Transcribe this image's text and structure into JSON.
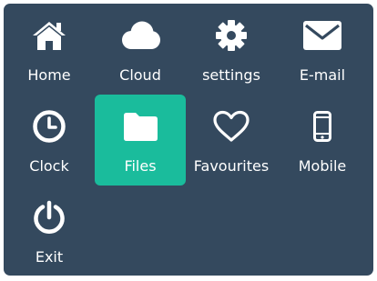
{
  "colors": {
    "panel_background": "#34495e",
    "active_tile_background": "#1abc9c",
    "icon_and_text": "#ffffff"
  },
  "menu": {
    "active_item": "Files",
    "items": [
      {
        "label": "Home",
        "icon": "home-icon"
      },
      {
        "label": "Cloud",
        "icon": "cloud-icon"
      },
      {
        "label": "settings",
        "icon": "gear-icon"
      },
      {
        "label": "E-mail",
        "icon": "envelope-icon"
      },
      {
        "label": "Clock",
        "icon": "clock-icon"
      },
      {
        "label": "Files",
        "icon": "folder-icon"
      },
      {
        "label": "Favourites",
        "icon": "heart-icon"
      },
      {
        "label": "Mobile",
        "icon": "mobile-phone-icon"
      },
      {
        "label": "Exit",
        "icon": "power-icon"
      }
    ]
  }
}
